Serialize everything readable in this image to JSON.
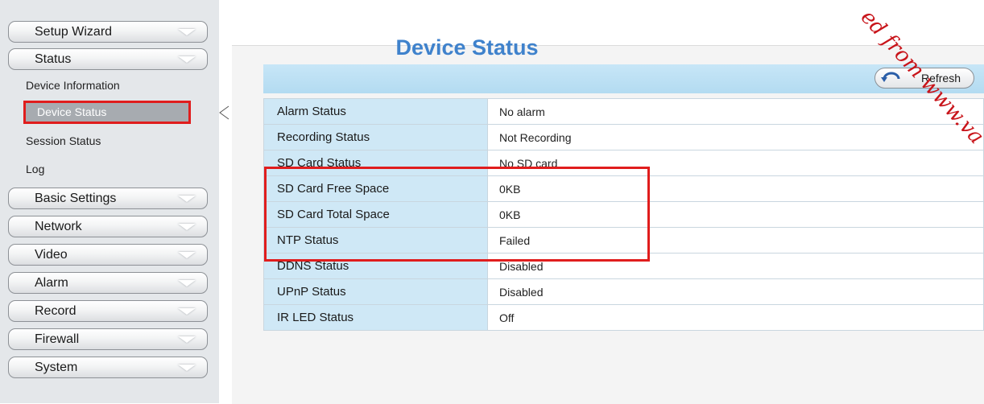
{
  "sidebar": {
    "menu": [
      {
        "id": "setup-wizard",
        "label": "Setup Wizard"
      },
      {
        "id": "status",
        "label": "Status"
      },
      {
        "id": "basic-settings",
        "label": "Basic Settings"
      },
      {
        "id": "network",
        "label": "Network"
      },
      {
        "id": "video",
        "label": "Video"
      },
      {
        "id": "alarm",
        "label": "Alarm"
      },
      {
        "id": "record",
        "label": "Record"
      },
      {
        "id": "firewall",
        "label": "Firewall"
      },
      {
        "id": "system",
        "label": "System"
      }
    ],
    "status_subitems": [
      {
        "label": "Device Information"
      },
      {
        "label": "Device Status",
        "active": true
      },
      {
        "label": "Session Status"
      },
      {
        "label": "Log"
      }
    ]
  },
  "main": {
    "title": "Device Status",
    "refresh_label": "Refresh",
    "rows": [
      {
        "label": "Alarm Status",
        "value": "No alarm"
      },
      {
        "label": "Recording Status",
        "value": "Not Recording"
      },
      {
        "label": "SD Card Status",
        "value": "No SD card"
      },
      {
        "label": "SD Card Free Space",
        "value": "0KB"
      },
      {
        "label": "SD Card Total Space",
        "value": "0KB"
      },
      {
        "label": "NTP Status",
        "value": "Failed"
      },
      {
        "label": "DDNS Status",
        "value": "Disabled"
      },
      {
        "label": "UPnP Status",
        "value": "Disabled"
      },
      {
        "label": "IR LED Status",
        "value": "Off"
      }
    ]
  },
  "watermark": {
    "text": "ed from www.va"
  },
  "colors": {
    "title_blue": "#3f82cc",
    "highlight_red": "#e01d1d",
    "label_bg": "#cfe8f6",
    "toolbar_bg": "#c7e6f7",
    "active_item_bg": "#a7abb0"
  },
  "icons": {
    "menu_chevron": "chevron-down-icon",
    "refresh": "refresh-icon"
  }
}
